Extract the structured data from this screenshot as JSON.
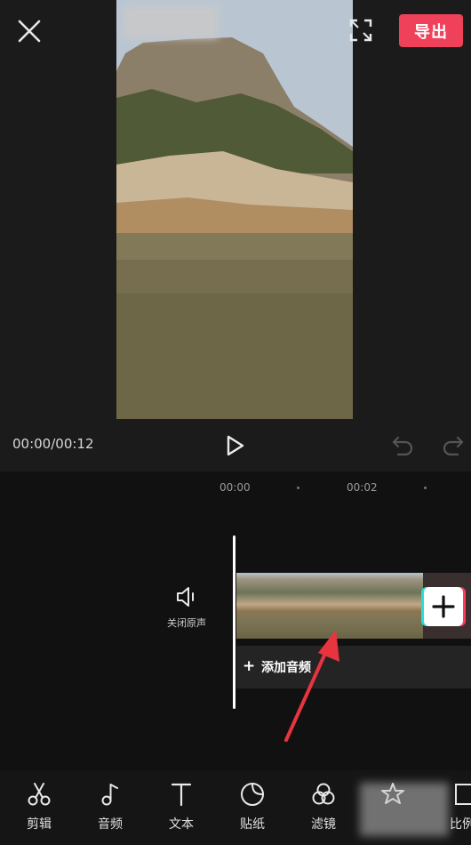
{
  "header": {
    "export_label": "导出"
  },
  "player": {
    "time_readout": "00:00/00:12"
  },
  "timeline": {
    "ruler": [
      "00:00",
      "00:02"
    ],
    "mute_label": "关闭原声",
    "add_audio_label": "添加音频"
  },
  "toolbar": {
    "items": [
      {
        "label": "剪辑",
        "icon": "scissors-icon"
      },
      {
        "label": "音频",
        "icon": "music-note-icon"
      },
      {
        "label": "文本",
        "icon": "text-icon"
      },
      {
        "label": "贴纸",
        "icon": "sticker-icon"
      },
      {
        "label": "滤镜",
        "icon": "filter-icon"
      },
      {
        "label": "",
        "icon": "effects-star-icon"
      },
      {
        "label": "比例",
        "icon": "ratio-icon"
      }
    ]
  },
  "colors": {
    "accent": "#f0415b",
    "background": "#111111",
    "annotation_arrow": "#e8343f"
  }
}
